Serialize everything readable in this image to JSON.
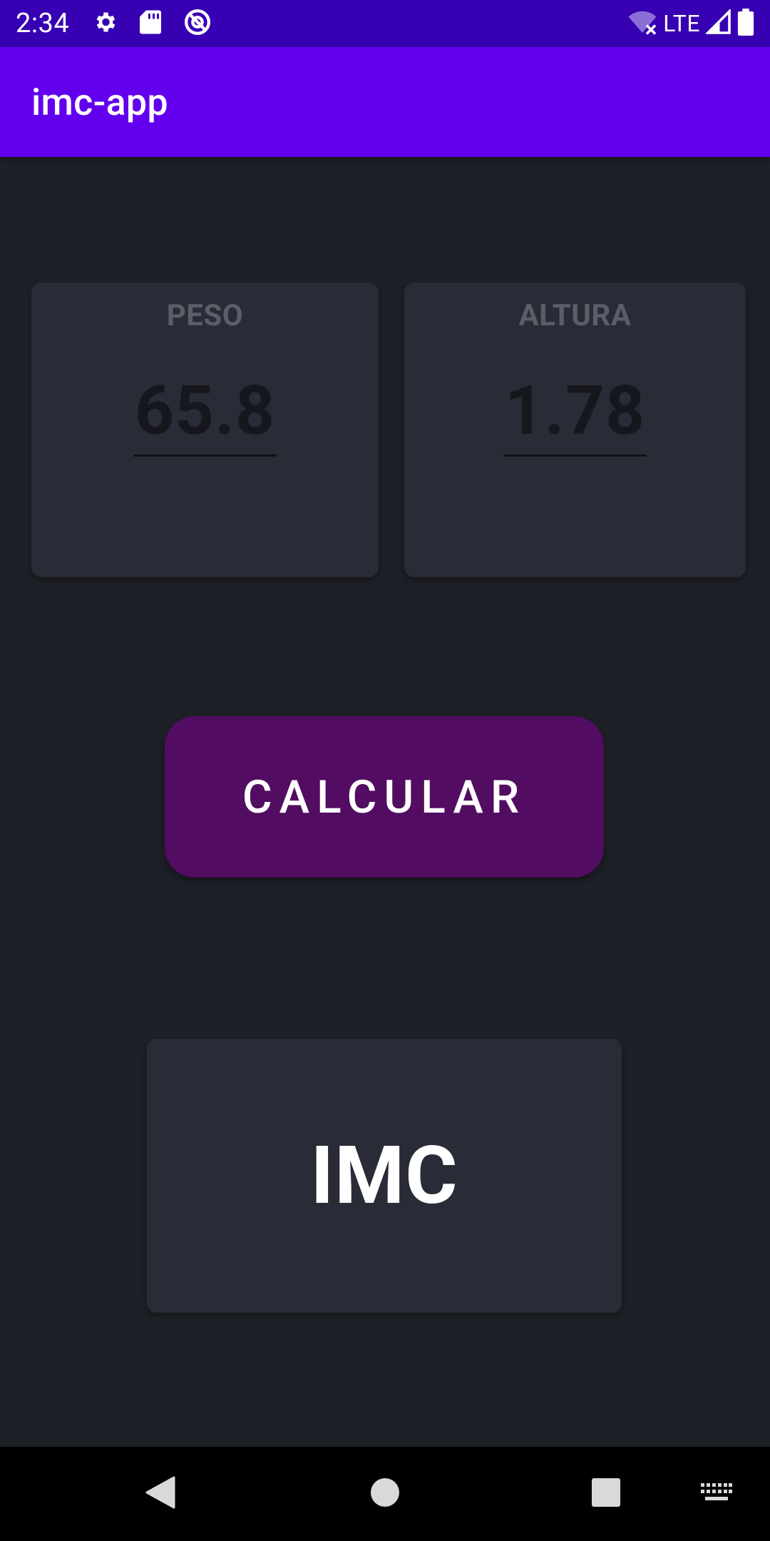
{
  "status_bar": {
    "time": "2:34",
    "icons_left": [
      "gear-icon",
      "sd-card-icon",
      "do-not-disturb-icon"
    ],
    "network_label": "LTE",
    "icons_right": [
      "wifi-off-icon",
      "signal-icon",
      "battery-icon"
    ],
    "background_color": "#3700b3"
  },
  "app_bar": {
    "title": "imc-app",
    "background_color": "#6200ee"
  },
  "peso_card": {
    "label": "PESO",
    "value": "65.8"
  },
  "altura_card": {
    "label": "ALTURA",
    "value": "1.78"
  },
  "calculate_button": {
    "label": "CALCULAR",
    "color": "#520c61"
  },
  "result_card": {
    "text": "IMC"
  },
  "nav_bar": {
    "buttons": [
      "back-icon",
      "home-icon",
      "recents-icon",
      "keyboard-icon"
    ]
  }
}
